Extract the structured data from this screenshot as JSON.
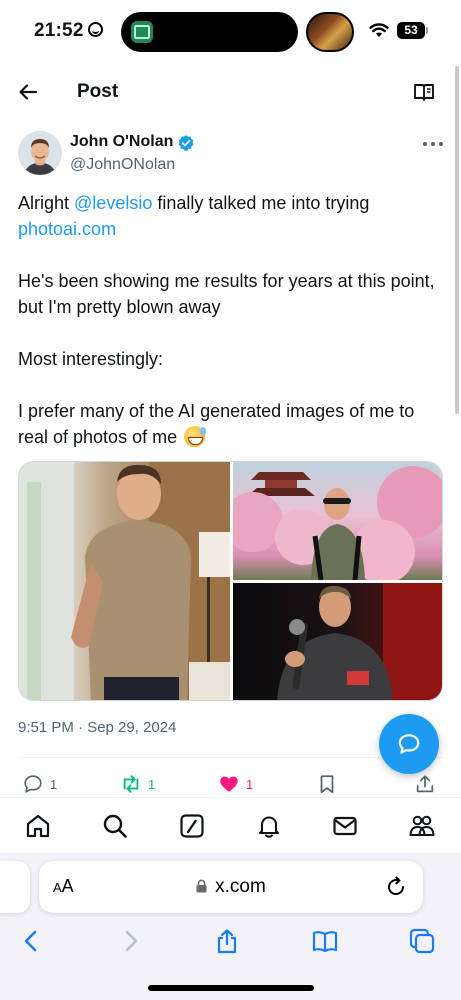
{
  "status_bar": {
    "time": "21:52",
    "battery": "53"
  },
  "header": {
    "title": "Post"
  },
  "post": {
    "author_name": "John O'Nolan",
    "author_handle": "@JohnONolan",
    "text": {
      "p1_prefix": "Alright ",
      "p1_mention": "@levelsio",
      "p1_middle": " finally talked me into trying ",
      "p1_link": "photoai.com",
      "p2": "He's been showing me results for years at this point, but I'm pretty blown away",
      "p3": "Most interestingly:",
      "p4": "I prefer many of the AI generated images of me to real of photos of me"
    },
    "timestamp": "9:51 PM · Sep 29, 2024",
    "counts": {
      "replies": "1",
      "reposts": "1",
      "likes": "1"
    }
  },
  "safari": {
    "aa_label_small": "A",
    "aa_label_large": "A",
    "url": "x.com"
  },
  "colors": {
    "accent": "#1d9bf0",
    "retweet": "#00ba7c",
    "like": "#f91880",
    "secondary_text": "#536471"
  },
  "icons": {
    "back": "arrow-left-icon",
    "reader": "book-icon",
    "verified": "verified-badge-icon",
    "more": "more-horizontal-icon",
    "reply": "speech-bubble-icon",
    "repost": "repost-icon",
    "like": "heart-icon",
    "bookmark": "bookmark-icon",
    "share": "share-icon",
    "compose_fab": "chat-bubble-icon"
  }
}
